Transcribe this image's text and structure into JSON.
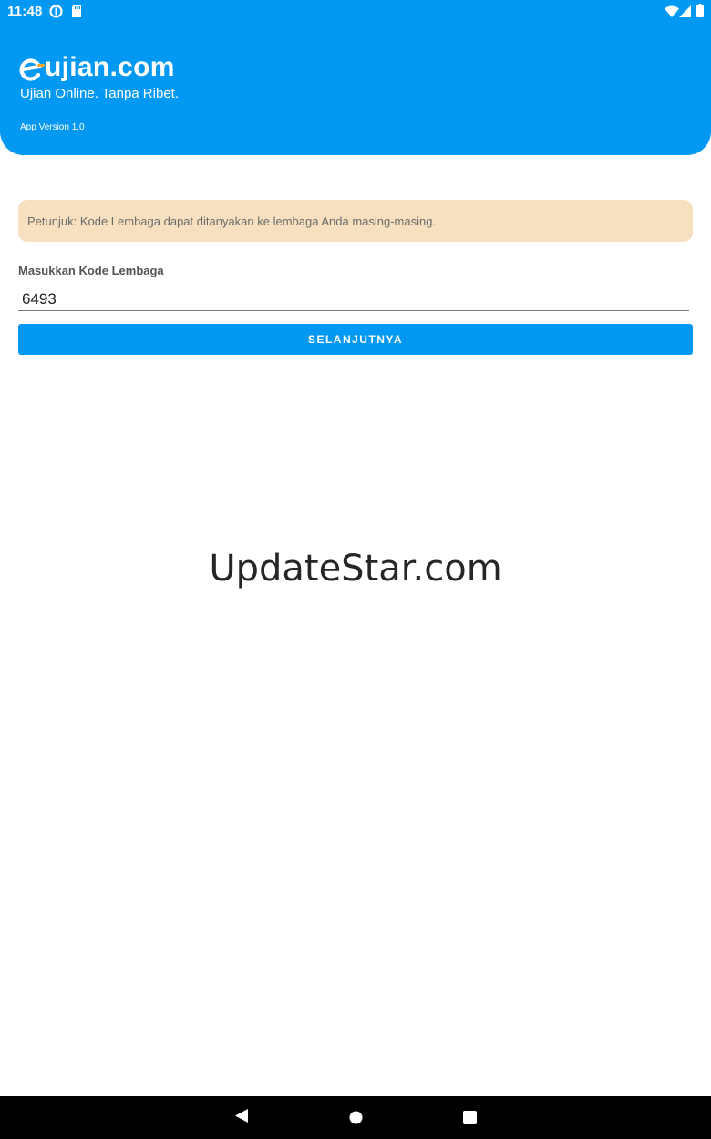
{
  "status_bar": {
    "time": "11:48",
    "left_icons": [
      "data-saver-icon",
      "sd-card-icon"
    ],
    "right_icons": [
      "wifi-icon",
      "cellular-signal-icon",
      "battery-icon"
    ]
  },
  "header": {
    "logo": {
      "prefix_glyph": "e",
      "text": "ujian.com"
    },
    "tagline": "Ujian Online. Tanpa Ribet.",
    "version": "App Version 1.0"
  },
  "hint": {
    "text": "Petunjuk: Kode Lembaga dapat ditanyakan ke lembaga Anda masing-masing."
  },
  "form": {
    "label": "Masukkan Kode Lembaga",
    "code_value": "6493",
    "submit_label": "SELANJUTNYA"
  },
  "watermark": "UpdateStar.com",
  "nav_bar": {
    "buttons": [
      "back-icon",
      "home-icon",
      "recents-icon"
    ]
  },
  "colors": {
    "primary": "#0398f2",
    "hint_bg": "#f6e0bf",
    "accent": "#f5a623"
  }
}
